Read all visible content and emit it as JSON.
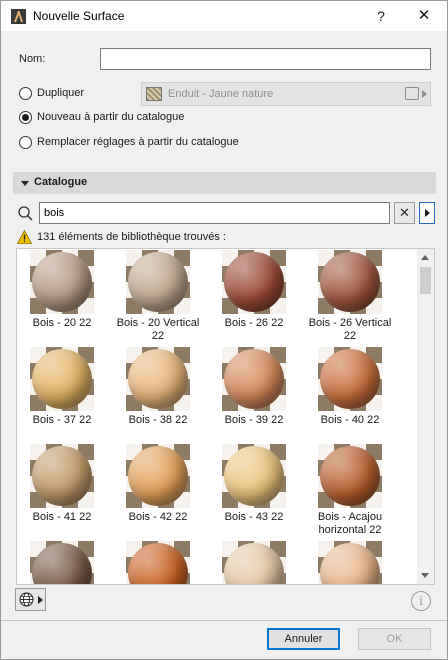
{
  "window": {
    "title": "Nouvelle Surface",
    "help_label": "?",
    "close_label": "✕"
  },
  "form": {
    "name_label": "Nom:",
    "name_value": "",
    "options": [
      {
        "label": "Dupliquer",
        "checked": false
      },
      {
        "label": "Nouveau à partir du catalogue",
        "checked": true
      },
      {
        "label": "Remplacer réglages à partir du catalogue",
        "checked": false
      }
    ],
    "duplicate_source": "Enduit - Jaune nature"
  },
  "catalogue": {
    "section_title": "Catalogue",
    "search_value": "bois",
    "clear_label": "✕",
    "results_text": "131 éléments de bibliothèque trouvés :",
    "items": [
      {
        "label": "Bois - 20 22",
        "color": "#b89a84"
      },
      {
        "label": "Bois - 20 Vertical 22",
        "color": "#c2a88e"
      },
      {
        "label": "Bois - 26 22",
        "color": "#9a4a32"
      },
      {
        "label": "Bois - 26 Vertical 22",
        "color": "#a0573b"
      },
      {
        "label": "Bois - 37 22",
        "color": "#e4b266"
      },
      {
        "label": "Bois - 38 22",
        "color": "#e8b57a"
      },
      {
        "label": "Bois - 39 22",
        "color": "#d4895a"
      },
      {
        "label": "Bois - 40 22",
        "color": "#c86f3c"
      },
      {
        "label": "Bois - 41 22",
        "color": "#c49a68"
      },
      {
        "label": "Bois - 42 22",
        "color": "#e2a05a"
      },
      {
        "label": "Bois - 43 22",
        "color": "#edc47e"
      },
      {
        "label": "Bois - Acajou horizontal 22",
        "color": "#b8602e"
      },
      {
        "label": "",
        "color": "#7a5a46"
      },
      {
        "label": "",
        "color": "#c86224"
      },
      {
        "label": "",
        "color": "#e6c7a2"
      },
      {
        "label": "",
        "color": "#e8b48a"
      }
    ]
  },
  "footer": {
    "info_label": "i",
    "cancel_label": "Annuler",
    "ok_label": "OK"
  }
}
